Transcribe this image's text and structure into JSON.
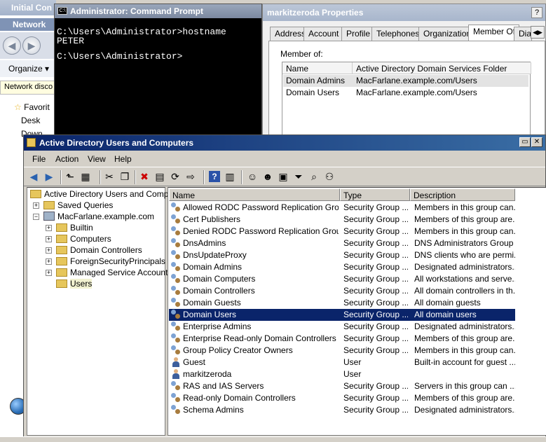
{
  "bg_window": {
    "title": "Initial Con",
    "network_label": "Network",
    "organize_label": "Organize",
    "discovery_text": "Network disco",
    "favorites_label": "Favorit",
    "desktop_label": "Desk",
    "downloads_label": "Down"
  },
  "cmd": {
    "title": "Administrator: Command Prompt",
    "lines": [
      "C:\\Users\\Administrator>hostname",
      "PETER",
      "",
      "C:\\Users\\Administrator>"
    ]
  },
  "props": {
    "title": "markitzeroda Properties",
    "tabs": [
      "Address",
      "Account",
      "Profile",
      "Telephones",
      "Organization",
      "Member Of",
      "Dial"
    ],
    "member_of_label": "Member of:",
    "columns": [
      "Name",
      "Active Directory Domain Services Folder"
    ],
    "rows": [
      {
        "name": "Domain Admins",
        "folder": "MacFarlane.example.com/Users"
      },
      {
        "name": "Domain Users",
        "folder": "MacFarlane.example.com/Users"
      }
    ]
  },
  "aduc": {
    "title": "Active Directory Users and Computers",
    "menus": [
      "File",
      "Action",
      "View",
      "Help"
    ],
    "tree": {
      "root": "Active Directory Users and Comput",
      "saved_queries": "Saved Queries",
      "domain": "MacFarlane.example.com",
      "children": [
        "Builtin",
        "Computers",
        "Domain Controllers",
        "ForeignSecurityPrincipals",
        "Managed Service Accounts",
        "Users"
      ]
    },
    "columns": [
      "Name",
      "Type",
      "Description"
    ],
    "rows": [
      {
        "name": "Allowed RODC Password Replication Group",
        "type": "Security Group ...",
        "desc": "Members in this group can...",
        "kind": "group"
      },
      {
        "name": "Cert Publishers",
        "type": "Security Group ...",
        "desc": "Members of this group are...",
        "kind": "group"
      },
      {
        "name": "Denied RODC Password Replication Group",
        "type": "Security Group ...",
        "desc": "Members in this group can...",
        "kind": "group"
      },
      {
        "name": "DnsAdmins",
        "type": "Security Group ...",
        "desc": "DNS Administrators Group",
        "kind": "group"
      },
      {
        "name": "DnsUpdateProxy",
        "type": "Security Group ...",
        "desc": "DNS clients who are permi...",
        "kind": "group"
      },
      {
        "name": "Domain Admins",
        "type": "Security Group ...",
        "desc": "Designated administrators...",
        "kind": "group"
      },
      {
        "name": "Domain Computers",
        "type": "Security Group ...",
        "desc": "All workstations and serve...",
        "kind": "group"
      },
      {
        "name": "Domain Controllers",
        "type": "Security Group ...",
        "desc": "All domain controllers in th...",
        "kind": "group"
      },
      {
        "name": "Domain Guests",
        "type": "Security Group ...",
        "desc": "All domain guests",
        "kind": "group"
      },
      {
        "name": "Domain Users",
        "type": "Security Group ...",
        "desc": "All domain users",
        "kind": "group"
      },
      {
        "name": "Enterprise Admins",
        "type": "Security Group ...",
        "desc": "Designated administrators...",
        "kind": "group"
      },
      {
        "name": "Enterprise Read-only Domain Controllers",
        "type": "Security Group ...",
        "desc": "Members of this group are...",
        "kind": "group"
      },
      {
        "name": "Group Policy Creator Owners",
        "type": "Security Group ...",
        "desc": "Members in this group can...",
        "kind": "group"
      },
      {
        "name": "Guest",
        "type": "User",
        "desc": "Built-in account for guest ...",
        "kind": "user"
      },
      {
        "name": "markitzeroda",
        "type": "User",
        "desc": "",
        "kind": "user"
      },
      {
        "name": "RAS and IAS Servers",
        "type": "Security Group ...",
        "desc": "Servers in this group can ...",
        "kind": "group"
      },
      {
        "name": "Read-only Domain Controllers",
        "type": "Security Group ...",
        "desc": "Members of this group are...",
        "kind": "group"
      },
      {
        "name": "Schema Admins",
        "type": "Security Group ...",
        "desc": "Designated administrators...",
        "kind": "group"
      }
    ]
  },
  "icons": {
    "tb": [
      "back-arrow-icon",
      "forward-arrow-icon",
      "up-folder-icon",
      "show-console-tree-icon",
      "cut-icon",
      "copy-icon",
      "delete-icon",
      "properties-icon",
      "refresh-icon",
      "export-list-icon",
      "help-icon",
      "action-pane-icon",
      "new-user-icon",
      "new-group-icon",
      "new-ou-icon",
      "filter-icon",
      "find-icon",
      "add-to-group-icon"
    ],
    "tb_glyphs": [
      "◀",
      "▶",
      "⬑",
      "▦",
      "✂",
      "❐",
      "✖",
      "▤",
      "⟳",
      "⇨",
      "?",
      "▥",
      "☺",
      "☻",
      "▣",
      "⏷",
      "⌕",
      "⚇"
    ]
  },
  "colors": {
    "selection": "#0a246a",
    "title_active": "#0a246a"
  }
}
